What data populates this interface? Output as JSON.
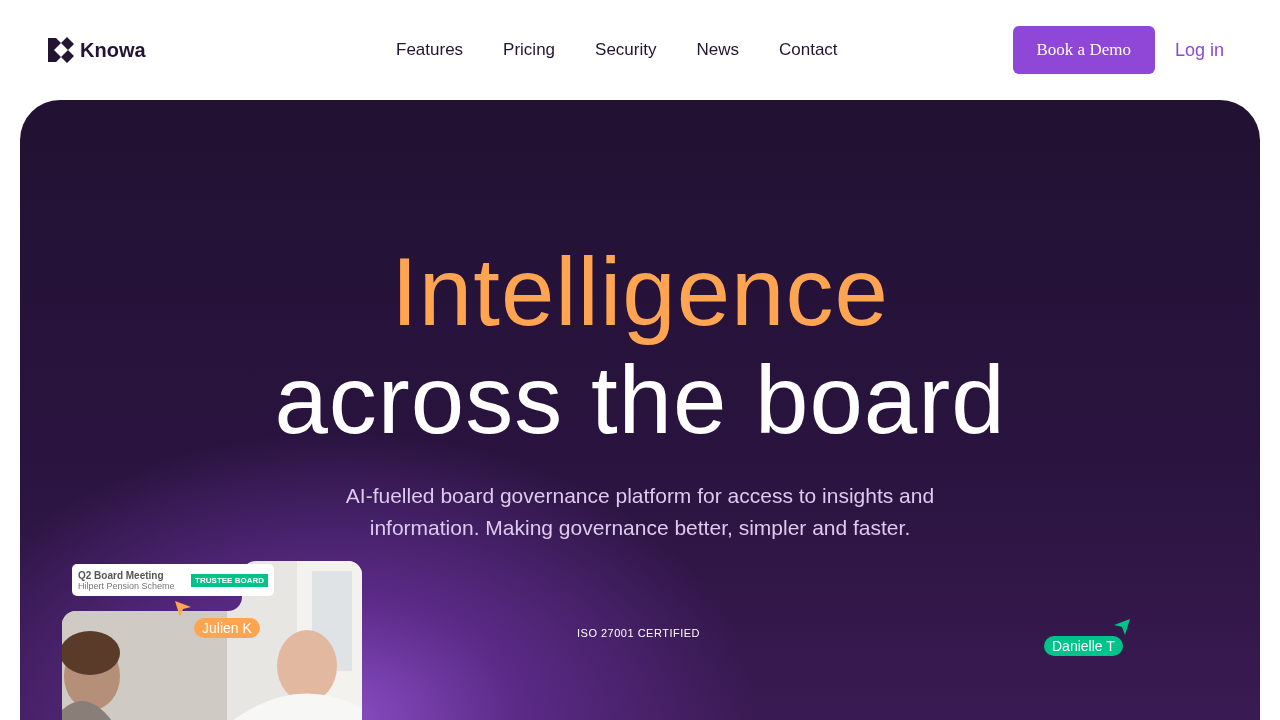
{
  "logo": {
    "name": "Knowa"
  },
  "nav": {
    "links": [
      "Features",
      "Pricing",
      "Security",
      "News",
      "Contact"
    ],
    "cta": "Book a Demo",
    "login": "Log in"
  },
  "hero": {
    "title_highlight": "Intelligence",
    "title_rest": "across the board",
    "subtitle": "AI-fuelled board governance platform for access to insights and information. Making governance better, simpler and faster.",
    "certification": "ISO 27001 CERTIFIED"
  },
  "meeting_card": {
    "title": "Q2 Board Meeting",
    "subtitle": "Hilpert Pension Scheme",
    "tag": {
      "label": "TRUSTEE BOARD",
      "color": "#00c389"
    }
  },
  "cursors": [
    {
      "name": "Julien K",
      "color": "#ffa552"
    },
    {
      "name": "Danielle T",
      "color": "#00c389"
    }
  ]
}
